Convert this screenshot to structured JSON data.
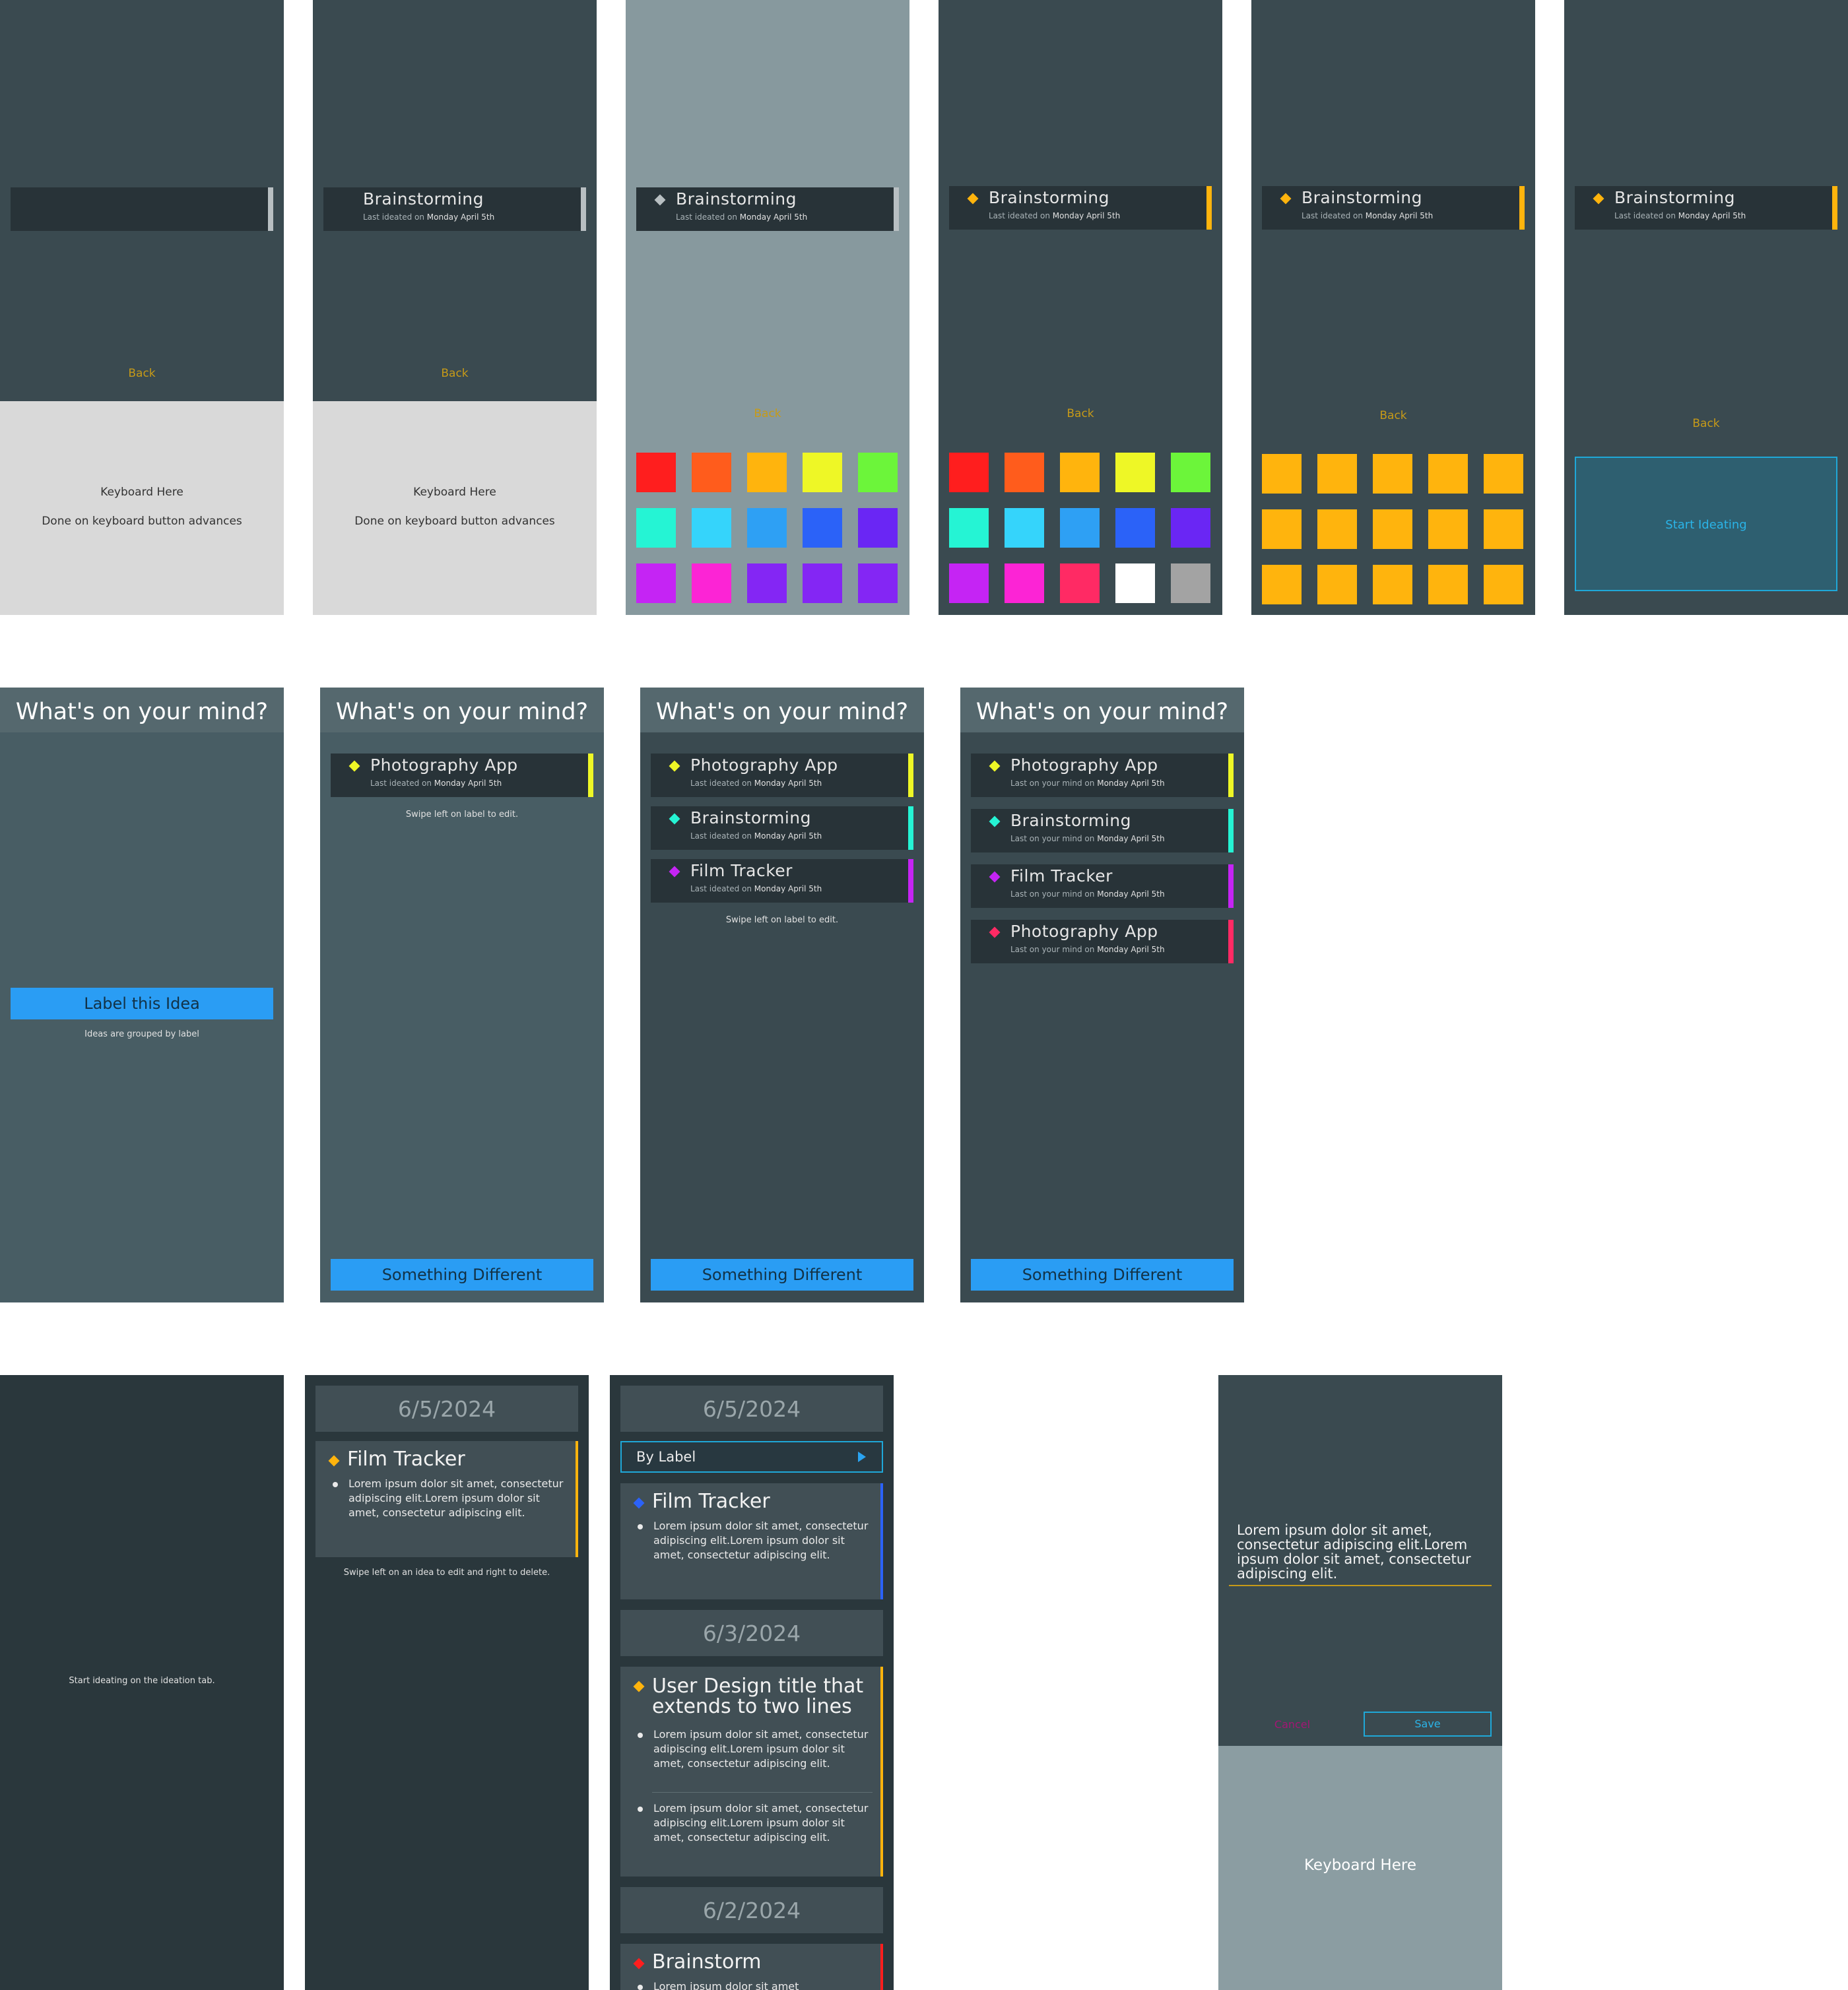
{
  "label_flow": {
    "s1": {
      "back": "Back",
      "keyboard_line1": "Keyboard Here",
      "keyboard_line2": "Done on keyboard button advances"
    },
    "s2": {
      "card_title": "Brainstorming",
      "card_sub_prefix": "Last ideated on",
      "card_sub_date": "Monday April 5th",
      "back": "Back",
      "keyboard_line1": "Keyboard Here",
      "keyboard_line2": "Done on keyboard button advances"
    },
    "s3": {
      "card_title": "Brainstorming",
      "card_sub_prefix": "Last ideated on",
      "card_sub_date": "Monday April 5th",
      "back": "Back",
      "swatches": [
        "#ff1e1e",
        "#ff5c1c",
        "#ffb40d",
        "#eef726",
        "#6cf53a",
        "#25f4d4",
        "#35d4fb",
        "#2ea0f4",
        "#2b62f8",
        "#6a26f4",
        "#c524f4",
        "#fc24d5",
        "#8426f4",
        "#8426f4",
        "#8426f4"
      ]
    },
    "s4": {
      "card_title": "Brainstorming",
      "card_sub_prefix": "Last ideated on",
      "card_sub_date": "Monday April 5th",
      "back": "Back",
      "accent": "#ffb40d",
      "swatches": [
        "#ff1e1e",
        "#ff5c1c",
        "#ffb40d",
        "#eef726",
        "#6cf53a",
        "#25f4d4",
        "#35d4fb",
        "#2ea0f4",
        "#2b62f8",
        "#6a26f4",
        "#c524f4",
        "#fc24d5",
        "#ff2a64",
        "#ffffff",
        "#a3a3a3"
      ]
    },
    "s5": {
      "card_title": "Brainstorming",
      "card_sub_prefix": "Last ideated on",
      "card_sub_date": "Monday April 5th",
      "back": "Back",
      "accent": "#ffb40d"
    },
    "s6": {
      "card_title": "Brainstorming",
      "card_sub_prefix": "Last ideated on",
      "card_sub_date": "Monday April 5th",
      "back": "Back",
      "start_button": "Start Ideating"
    }
  },
  "mind_flow": {
    "header": "What's on your mind?",
    "m1": {
      "label_button": "Label this Idea",
      "hint": "Ideas are grouped by label"
    },
    "m2": {
      "items": [
        {
          "title": "Photography App",
          "sub_prefix": "Last ideated on",
          "date": "Monday April 5th",
          "color": "#eef726"
        }
      ],
      "hint": "Swipe left on label to edit.",
      "bottom_button": "Something Different"
    },
    "m3": {
      "items": [
        {
          "title": "Photography App",
          "sub_prefix": "Last ideated on",
          "date": "Monday April 5th",
          "color": "#eef726"
        },
        {
          "title": "Brainstorming",
          "sub_prefix": "Last ideated on",
          "date": "Monday April 5th",
          "color": "#25f4d4"
        },
        {
          "title": "Film Tracker",
          "sub_prefix": "Last ideated on",
          "date": "Monday April 5th",
          "color": "#c524f4"
        }
      ],
      "hint": "Swipe left on label to edit.",
      "bottom_button": "Something Different"
    },
    "m4": {
      "items": [
        {
          "title": "Photography App",
          "sub_prefix": "Last on your mind on",
          "date": "Monday April 5th",
          "color": "#eef726"
        },
        {
          "title": "Brainstorming",
          "sub_prefix": "Last on your mind on",
          "date": "Monday April 5th",
          "color": "#25f4d4"
        },
        {
          "title": "Film Tracker",
          "sub_prefix": "Last on your mind on",
          "date": "Monday April 5th",
          "color": "#c524f4"
        },
        {
          "title": "Photography App",
          "sub_prefix": "Last on your mind on",
          "date": "Monday April 5th",
          "color": "#ff2a64"
        }
      ],
      "bottom_button": "Something Different"
    }
  },
  "history_flow": {
    "h1": {
      "empty_text": "Start ideating on the ideation tab."
    },
    "h2": {
      "date": "6/5/2024",
      "item_title": "Film Tracker",
      "item_body": "Lorem ipsum dolor sit amet, consectetur adipiscing elit.Lorem ipsum dolor sit amet, consectetur adipiscing elit.",
      "hint": "Swipe left on an idea to edit and right to delete."
    },
    "h3": {
      "date1": "6/5/2024",
      "filter": "By Label",
      "item1_title": "Film Tracker",
      "item1_body": "Lorem ipsum dolor sit amet, consectetur adipiscing elit.Lorem ipsum dolor sit amet, consectetur adipiscing elit.",
      "date2": "6/3/2024",
      "item2_title": "User Design title that extends to two lines",
      "item2_body1": "Lorem ipsum dolor sit amet, consectetur adipiscing elit.Lorem ipsum dolor sit amet, consectetur adipiscing elit.",
      "item2_body2": "Lorem ipsum dolor sit amet, consectetur adipiscing elit.Lorem ipsum dolor sit amet, consectetur adipiscing elit.",
      "date3": "6/2/2024",
      "item3_title": "Brainstorm",
      "item3_body": "Lorem ipsum dolor sit amet"
    },
    "edit": {
      "text": "Lorem ipsum dolor sit amet, consectetur adipiscing elit.Lorem ipsum dolor sit amet, consectetur adipiscing elit.",
      "cancel": "Cancel",
      "save": "Save",
      "keyboard": "Keyboard Here"
    }
  }
}
